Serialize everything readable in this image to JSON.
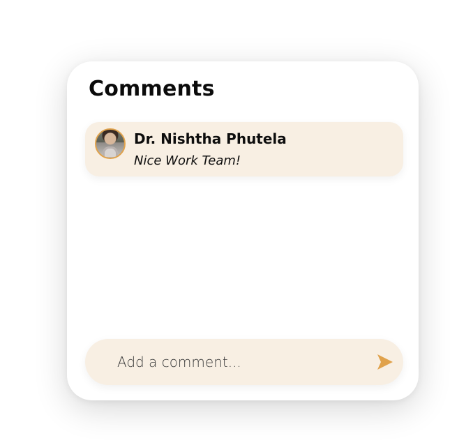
{
  "panel": {
    "title": "Comments"
  },
  "comments": [
    {
      "author": "Dr. Nishtha Phutela",
      "text": "Nice Work Team!",
      "avatar_icon": "user-photo-avatar"
    }
  ],
  "composer": {
    "placeholder": "Add a comment...",
    "value": "",
    "send_icon": "send-icon"
  },
  "colors": {
    "card_background": "#ffffff",
    "comment_background": "#f8efe3",
    "accent": "#e0a24c",
    "text": "#0d0d0d"
  }
}
